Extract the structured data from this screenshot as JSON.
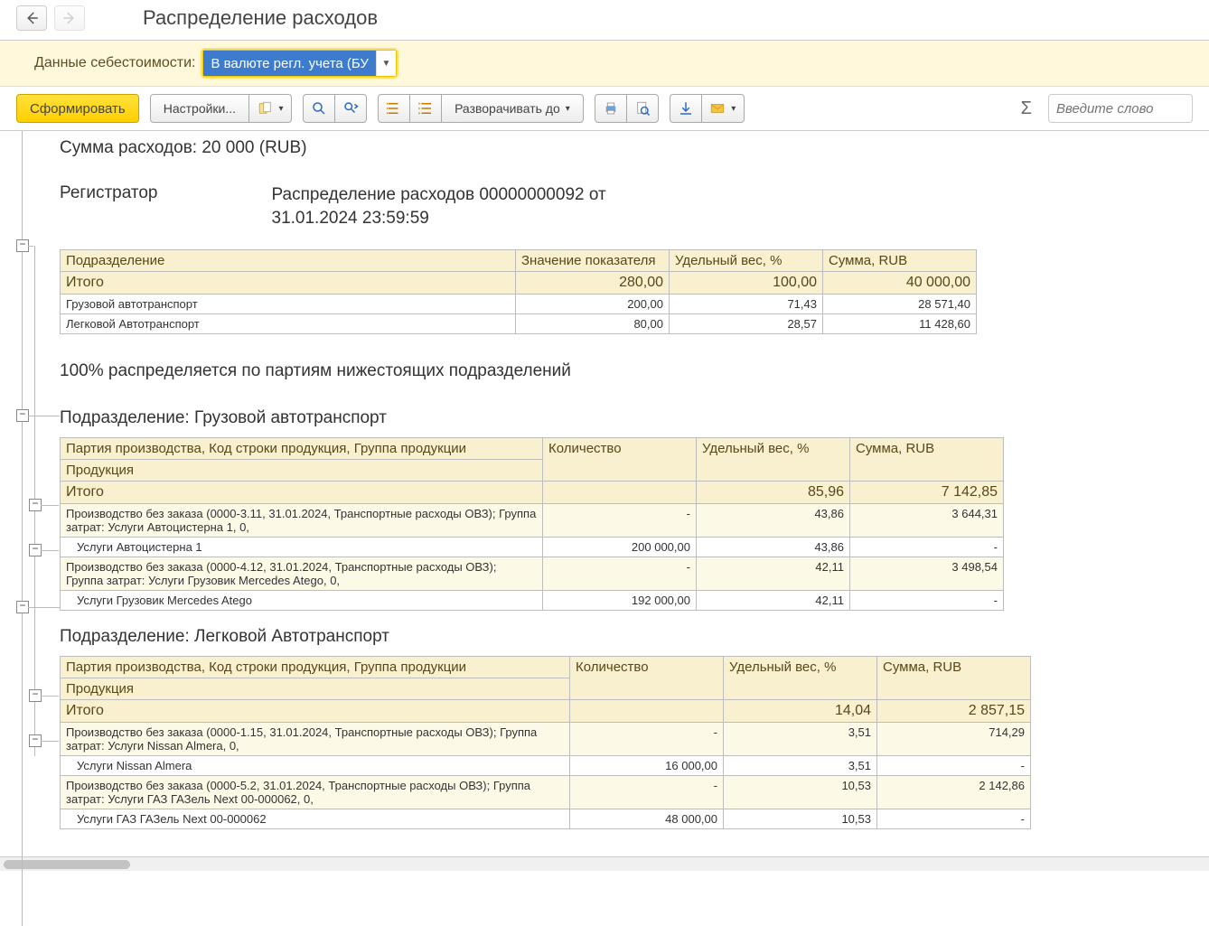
{
  "nav": {
    "title": "Распределение расходов"
  },
  "param": {
    "label": "Данные себестоимости:",
    "value": "В валюте регл. учета (БУ"
  },
  "toolbar": {
    "generate": "Сформировать",
    "settings": "Настройки...",
    "expand": "Разворачивать до",
    "find_placeholder": "Введите слово"
  },
  "summary": {
    "sum_label": "Сумма расходов: 20 000 (RUB)",
    "registrar_label": "Регистратор",
    "registrar_value": "Распределение расходов 00000000092 от 31.01.2024 23:59:59"
  },
  "t1": {
    "h": [
      "Подразделение",
      "Значение показателя",
      "Удельный вес, %",
      "Сумма, RUB"
    ],
    "total": [
      "Итого",
      "280,00",
      "100,00",
      "40 000,00"
    ],
    "rows": [
      [
        "Грузовой автотранспорт",
        "200,00",
        "71,43",
        "28 571,40"
      ],
      [
        "Легковой Автотранспорт",
        "80,00",
        "28,57",
        "11 428,60"
      ]
    ]
  },
  "dist_note": "100% распределяется по партиям нижестоящих подразделений",
  "sec1": {
    "title": "Подразделение: Грузовой автотранспорт",
    "h1": [
      "Партия производства, Код строки продукция, Группа продукции",
      "Количество",
      "Удельный вес, %",
      "Сумма, RUB"
    ],
    "h2": "Продукция",
    "total": {
      "label": "Итого",
      "weight": "85,96",
      "sum": "7 142,85"
    },
    "g1": {
      "label": "Производство без заказа (0000-3.11, 31.01.2024, Транспортные расходы ОВЗ); Группа затрат: Услуги Автоцистерна 1, 0,",
      "qty": "-",
      "weight": "43,86",
      "sum": "3 644,31",
      "leaf": {
        "label": "Услуги Автоцистерна 1",
        "qty": "200 000,00",
        "weight": "43,86",
        "sum": "-"
      }
    },
    "g2": {
      "label": "Производство без заказа (0000-4.12, 31.01.2024, Транспортные расходы ОВЗ); Группа затрат: Услуги Грузовик Mercedes Atego, 0,",
      "qty": "-",
      "weight": "42,11",
      "sum": "3 498,54",
      "leaf": {
        "label": "Услуги Грузовик Mercedes Atego",
        "qty": "192 000,00",
        "weight": "42,11",
        "sum": "-"
      }
    }
  },
  "sec2": {
    "title": "Подразделение: Легковой Автотранспорт",
    "h1": [
      "Партия производства, Код строки продукция, Группа продукции",
      "Количество",
      "Удельный вес, %",
      "Сумма, RUB"
    ],
    "h2": "Продукция",
    "total": {
      "label": "Итого",
      "weight": "14,04",
      "sum": "2 857,15"
    },
    "g1": {
      "label": "Производство без заказа (0000-1.15, 31.01.2024, Транспортные расходы ОВЗ); Группа затрат: Услуги  Nissan Almera, 0,",
      "qty": "-",
      "weight": "3,51",
      "sum": "714,29",
      "leaf": {
        "label": "Услуги  Nissan Almera",
        "qty": "16 000,00",
        "weight": "3,51",
        "sum": "-"
      }
    },
    "g2": {
      "label": "Производство без заказа (0000-5.2, 31.01.2024, Транспортные расходы ОВЗ); Группа затрат: Услуги  ГАЗ ГАЗель Next 00-000062, 0,",
      "qty": "-",
      "weight": "10,53",
      "sum": "2 142,86",
      "leaf": {
        "label": "Услуги  ГАЗ ГАЗель Next 00-000062",
        "qty": "48 000,00",
        "weight": "10,53",
        "sum": "-"
      }
    }
  }
}
